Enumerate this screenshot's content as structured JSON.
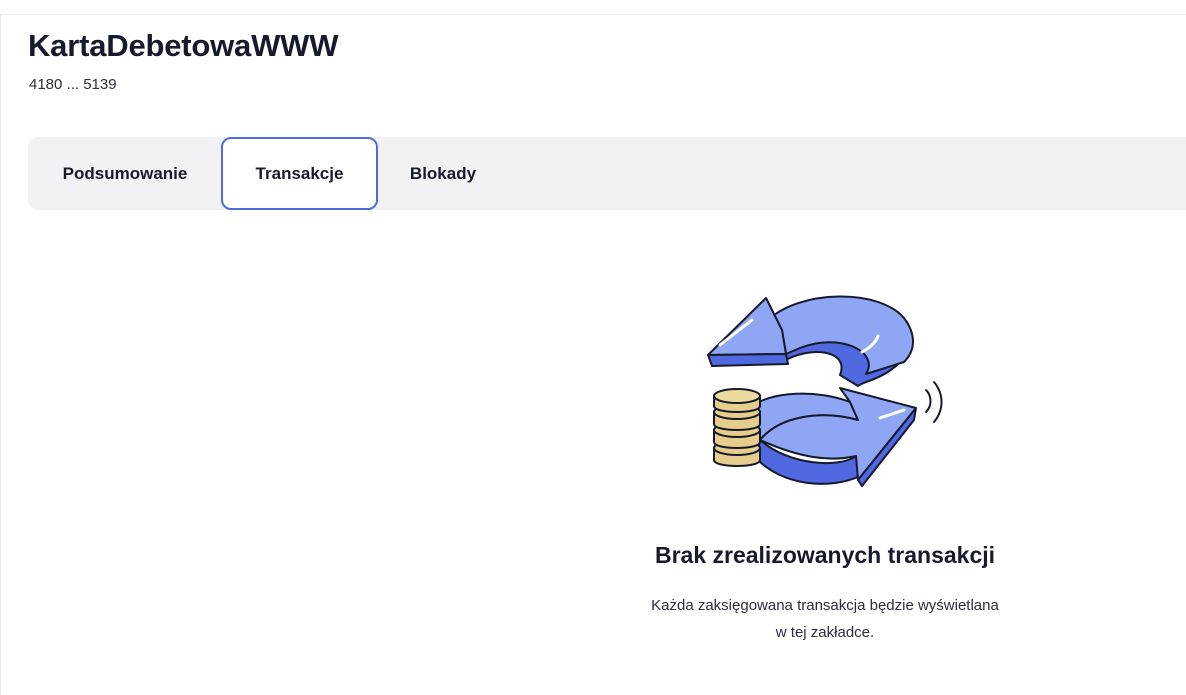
{
  "card": {
    "title": "KartaDebetowaWWW",
    "number": "4180 ... 5139"
  },
  "tabs": [
    {
      "label": "Podsumowanie",
      "active": false
    },
    {
      "label": "Transakcje",
      "active": true
    },
    {
      "label": "Blokady",
      "active": false
    }
  ],
  "empty_state": {
    "icon": "refresh-coins-icon",
    "title": "Brak zrealizowanych transakcji",
    "description_line1": "Każda zaksięgowana transakcja będzie wyświetlana",
    "description_line2": "w tej zakładce."
  },
  "colors": {
    "accent": "#4f6cdf",
    "tab_bar_bg": "#f2f2f4",
    "arrow_light": "#8fa6f5",
    "arrow_dark": "#5068e0",
    "coin_fill": "#e6cd8c"
  }
}
